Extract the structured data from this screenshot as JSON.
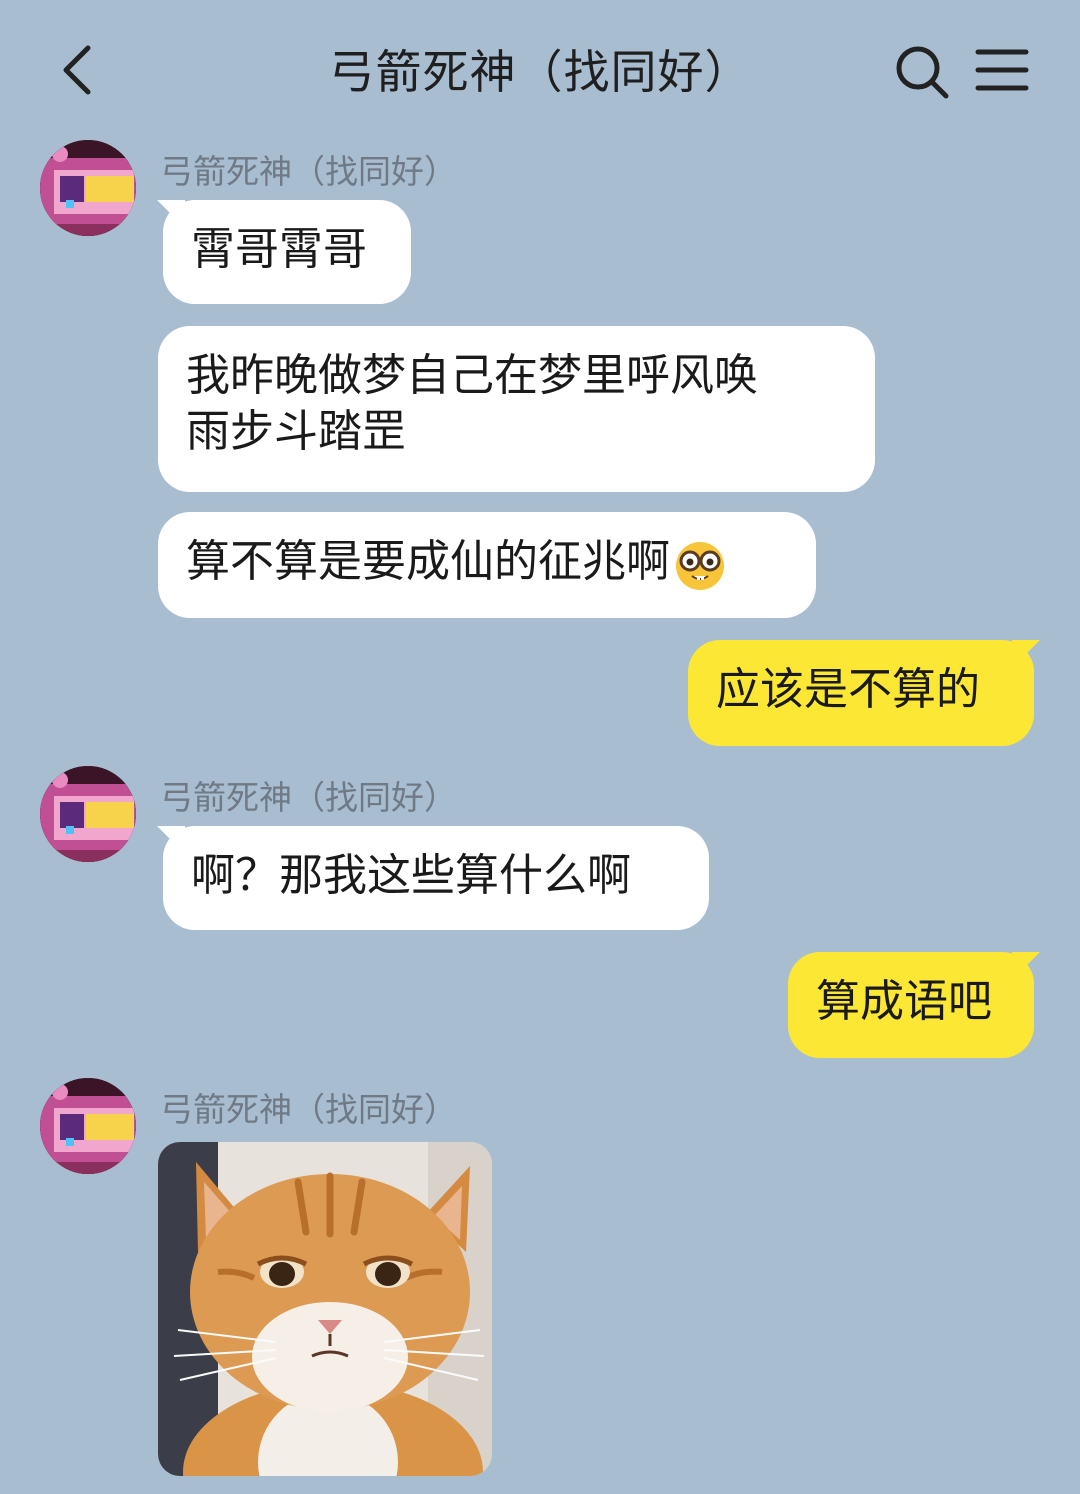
{
  "header": {
    "title": "弓箭死神（找同好）",
    "back_icon": "chevron-left-icon",
    "search_icon": "search-icon",
    "menu_icon": "hamburger-menu-icon"
  },
  "colors": {
    "background": "#a9bdd1",
    "incoming_bubble": "#ffffff",
    "outgoing_bubble": "#fde735"
  },
  "messages": [
    {
      "sender": "弓箭死神（找同好）",
      "text": "霄哥霄哥",
      "direction": "incoming"
    },
    {
      "text_line1": "我昨晚做梦自己在梦里呼风唤",
      "text_line2": "雨步斗踏罡",
      "direction": "incoming"
    },
    {
      "text": "算不算是要成仙的征兆啊",
      "emoji": "nerd-face-emoji",
      "direction": "incoming"
    },
    {
      "text": "应该是不算的",
      "direction": "outgoing"
    },
    {
      "sender": "弓箭死神（找同好）",
      "text": "啊？那我这些算什么啊",
      "direction": "incoming"
    },
    {
      "text": "算成语吧",
      "direction": "outgoing"
    },
    {
      "sender": "弓箭死神（找同好）",
      "image": "orange-cat-photo",
      "direction": "incoming"
    }
  ]
}
